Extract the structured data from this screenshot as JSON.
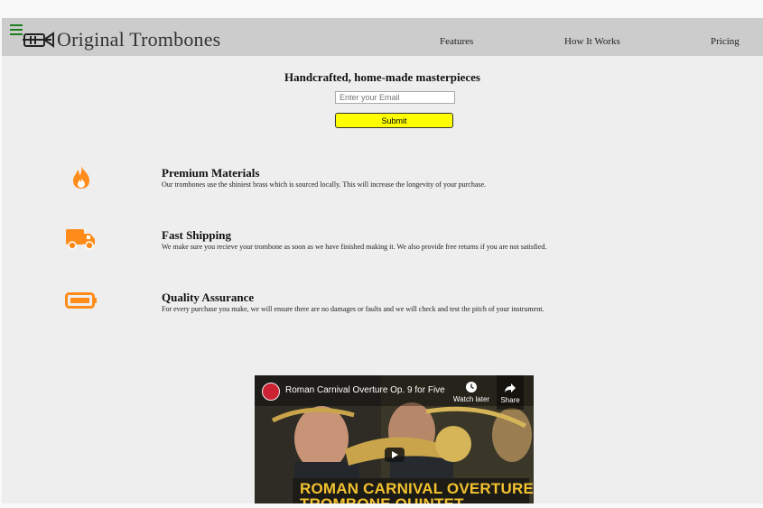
{
  "header": {
    "logo_text": "Original Trombones",
    "nav": [
      "Features",
      "How It Works",
      "Pricing"
    ]
  },
  "hero": {
    "heading": "Handcrafted, home-made masterpieces",
    "email_placeholder": "Enter your Email",
    "submit_label": "Submit"
  },
  "features": [
    {
      "icon": "fire-icon",
      "title": "Premium Materials",
      "desc": "Our trombones use the shiniest brass which is sourced locally. This will increase the longevity of your purchase."
    },
    {
      "icon": "truck-icon",
      "title": "Fast Shipping",
      "desc": "We make sure you recieve your trombone as soon as we have finished making it. We also provide free returns if you are not satisfied."
    },
    {
      "icon": "battery-icon",
      "title": "Quality Assurance",
      "desc": "For every purchase you make, we will ensure there are no damages or faults and we will check and test the pitch of your instrument."
    }
  ],
  "video": {
    "title": "Roman Carnival Overture Op. 9 for Five ...",
    "watch_later": "Watch later",
    "share": "Share",
    "banner_line1": "ROMAN CARNIVAL OVERTURE",
    "banner_line2": "TROMBONE QUINTET"
  },
  "colors": {
    "accent_orange": "#ff8c1a",
    "submit_yellow": "#ffff00",
    "navbar_gray": "#cccccc",
    "menu_green": "#1e7e1e"
  }
}
